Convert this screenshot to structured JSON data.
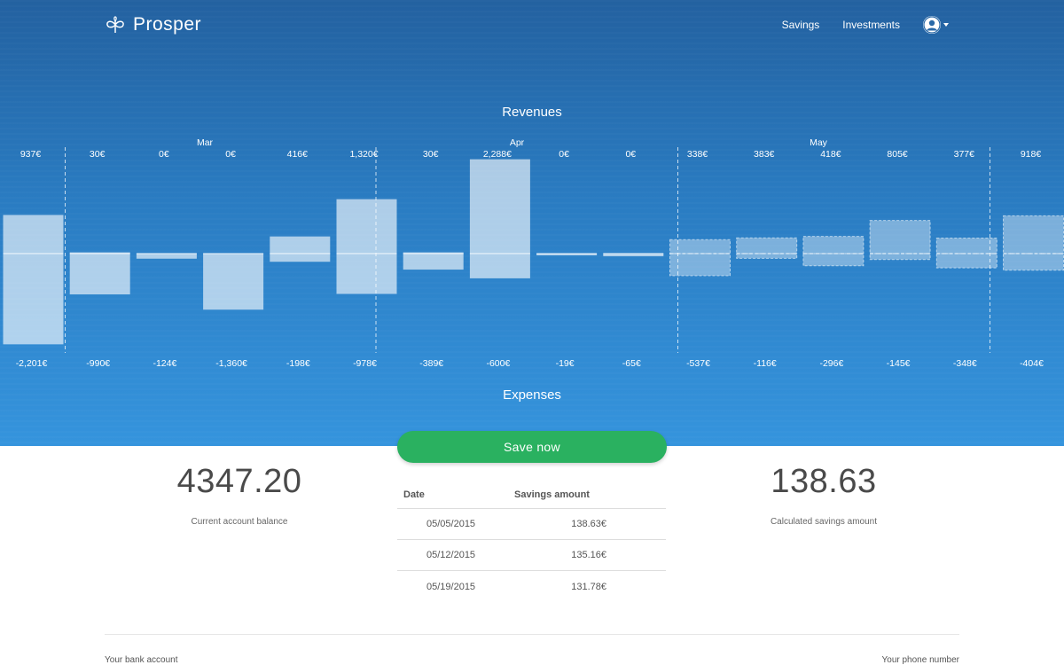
{
  "nav": {
    "brand": "Prosper",
    "links": [
      "Savings",
      "Investments"
    ]
  },
  "titles": {
    "revenues": "Revenues",
    "expenses": "Expenses"
  },
  "chart_data": {
    "type": "bar",
    "months": [
      {
        "label": "Mar"
      },
      {
        "label": "Apr"
      },
      {
        "label": "May"
      }
    ],
    "revenues": [
      937,
      30,
      0,
      0,
      416,
      1320,
      30,
      2288,
      0,
      0,
      338,
      383,
      418,
      805,
      377,
      918
    ],
    "expenses": [
      2201,
      990,
      124,
      1360,
      198,
      978,
      389,
      600,
      19,
      65,
      537,
      116,
      296,
      145,
      348,
      404
    ],
    "revenue_labels": [
      "937€",
      "30€",
      "0€",
      "0€",
      "416€",
      "1,320€",
      "30€",
      "2,288€",
      "0€",
      "0€",
      "338€",
      "383€",
      "418€",
      "805€",
      "377€",
      "918€"
    ],
    "expense_labels": [
      "-2,201€",
      "-990€",
      "-124€",
      "-1,360€",
      "-198€",
      "-978€",
      "-389€",
      "-600€",
      "-19€",
      "-65€",
      "-537€",
      "-116€",
      "-296€",
      "-145€",
      "-348€",
      "-404€"
    ],
    "projected_from_index": 10
  },
  "save_button": "Save now",
  "balance": {
    "value": "4347.20",
    "label": "Current account balance"
  },
  "savings": {
    "value": "138.63",
    "label": "Calculated savings amount"
  },
  "table": {
    "headers": [
      "Date",
      "Savings amount"
    ],
    "rows": [
      {
        "date": "05/05/2015",
        "amount": "138.63€"
      },
      {
        "date": "05/12/2015",
        "amount": "135.16€"
      },
      {
        "date": "05/19/2015",
        "amount": "131.78€"
      }
    ]
  },
  "footer": {
    "left": "Your bank account",
    "right": "Your phone number"
  },
  "colors": {
    "accent_green": "#2ab160",
    "hero_top": "#2361a0",
    "hero_bottom": "#3594dd"
  }
}
